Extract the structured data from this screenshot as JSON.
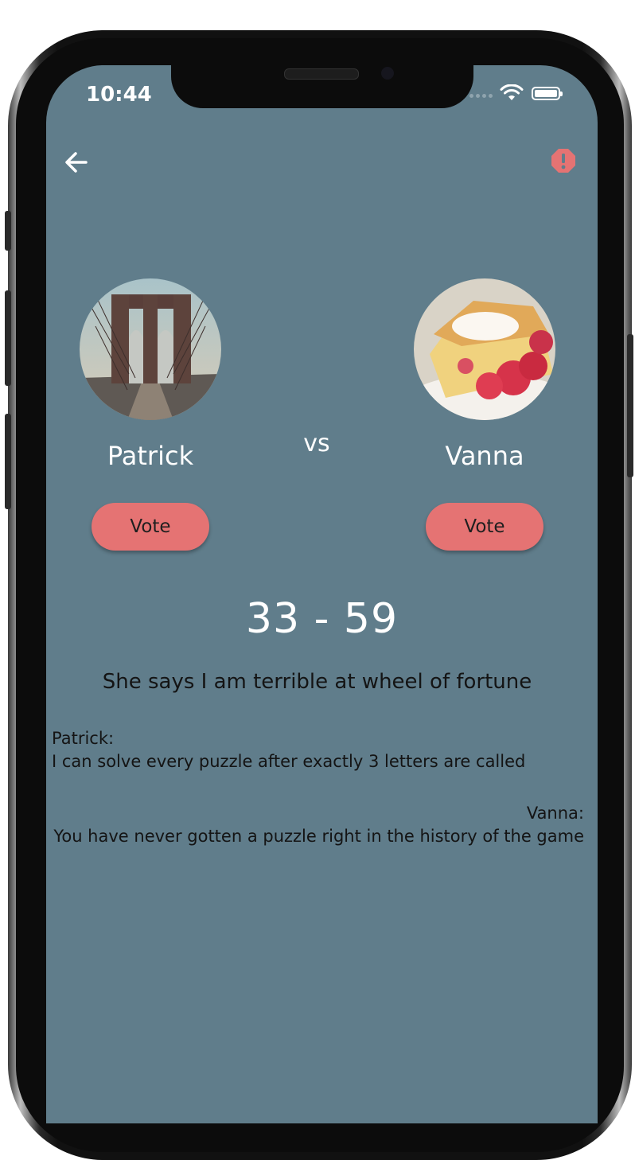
{
  "status_bar": {
    "time": "10:44"
  },
  "header": {
    "back_icon": "arrow-left-icon",
    "report_icon": "alert-octagon-icon",
    "report_color": "#e57373"
  },
  "left_contender": {
    "name": "Patrick",
    "vote_label": "Vote",
    "avatar": "bridge-photo"
  },
  "vs_label": "vs",
  "right_contender": {
    "name": "Vanna",
    "vote_label": "Vote",
    "avatar": "pie-photo"
  },
  "score": {
    "left": "33",
    "separator": "-",
    "right": "59",
    "display": "33 - 59"
  },
  "topic": "She says I am terrible at wheel of fortune",
  "arguments": {
    "left": {
      "speaker": "Patrick:",
      "text": "I can solve every puzzle after exactly 3 letters are called"
    },
    "right": {
      "speaker": "Vanna:",
      "text": "You have never gotten a puzzle right in the history of the game"
    }
  },
  "colors": {
    "screen_background": "#607d8b",
    "button": "#e57373",
    "text_dark": "#141414"
  }
}
